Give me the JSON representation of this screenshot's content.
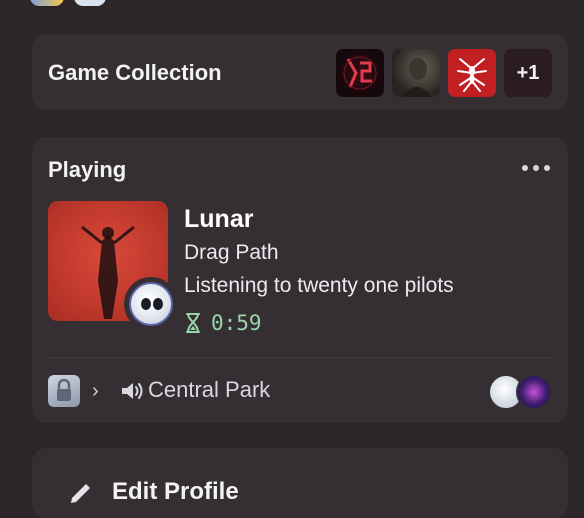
{
  "collection": {
    "title": "Game Collection",
    "games": [
      {
        "icon": "dmc5-cover"
      },
      {
        "icon": "resident-evil-cover"
      },
      {
        "icon": "spider-man-cover"
      }
    ],
    "more_count": "+1"
  },
  "playing": {
    "title": "Playing",
    "song": "Lunar",
    "album": "Drag Path",
    "listening": "Listening to twenty one pilots",
    "timer": "0:59",
    "timer_color": "#98d7a8"
  },
  "voice": {
    "channel": "Central Park"
  },
  "edit": {
    "label": "Edit Profile"
  },
  "colors": {
    "background": "#2c2629",
    "card": "#352f33",
    "accent_red": "#c23a2d"
  }
}
